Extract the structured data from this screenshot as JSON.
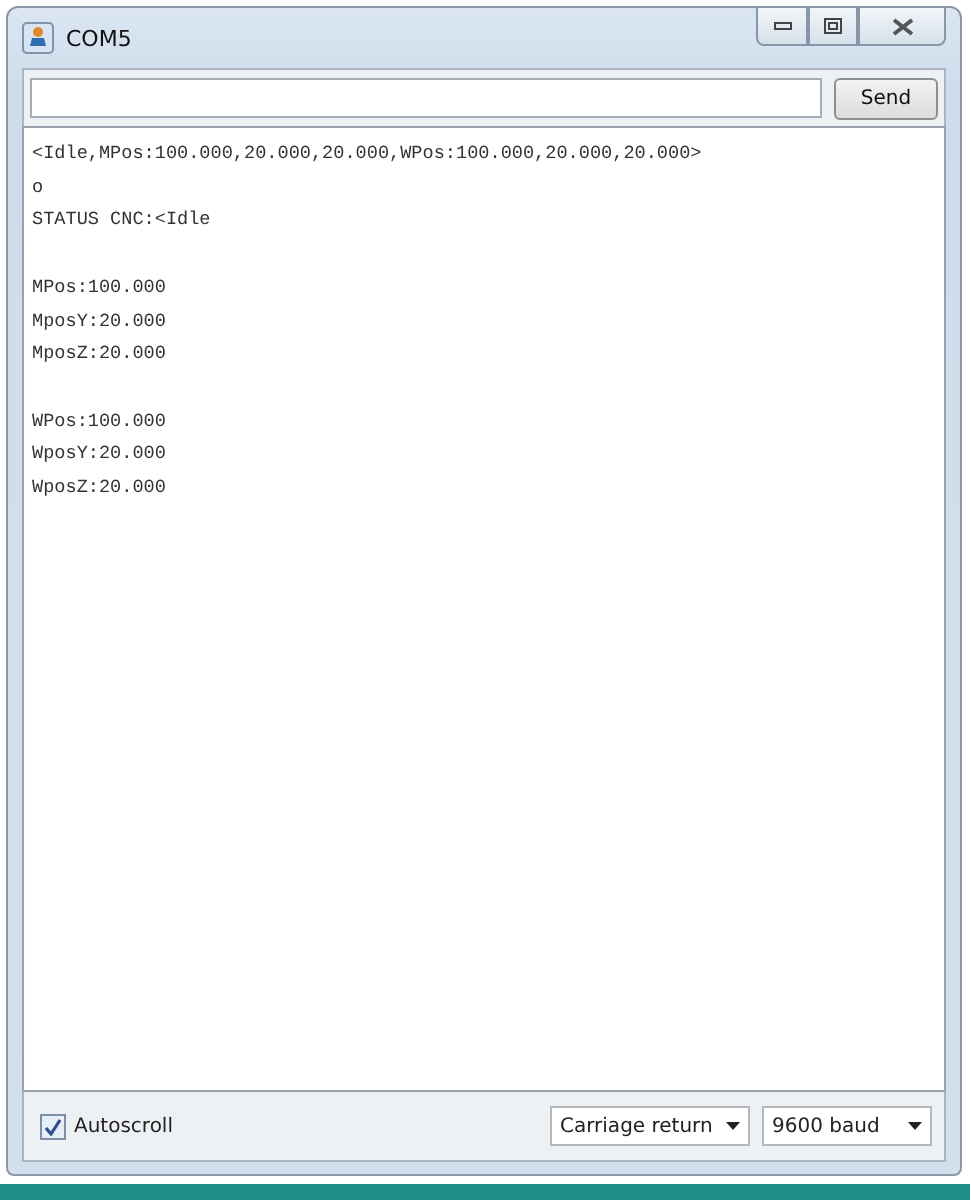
{
  "window": {
    "title": "COM5"
  },
  "send_button": "Send",
  "output_blocks": [
    [
      "<Idle,MPos:100.000,20.000,20.000,WPos:100.000,20.000,20.000>",
      "o",
      "STATUS CNC:<Idle"
    ],
    [
      "MPos:100.000",
      "MposY:20.000",
      "MposZ:20.000"
    ],
    [
      "WPos:100.000",
      "WposY:20.000",
      "WposZ:20.000"
    ]
  ],
  "autoscroll": {
    "label": "Autoscroll",
    "checked": true
  },
  "line_ending": "Carriage return",
  "baud_rate": "9600 baud"
}
